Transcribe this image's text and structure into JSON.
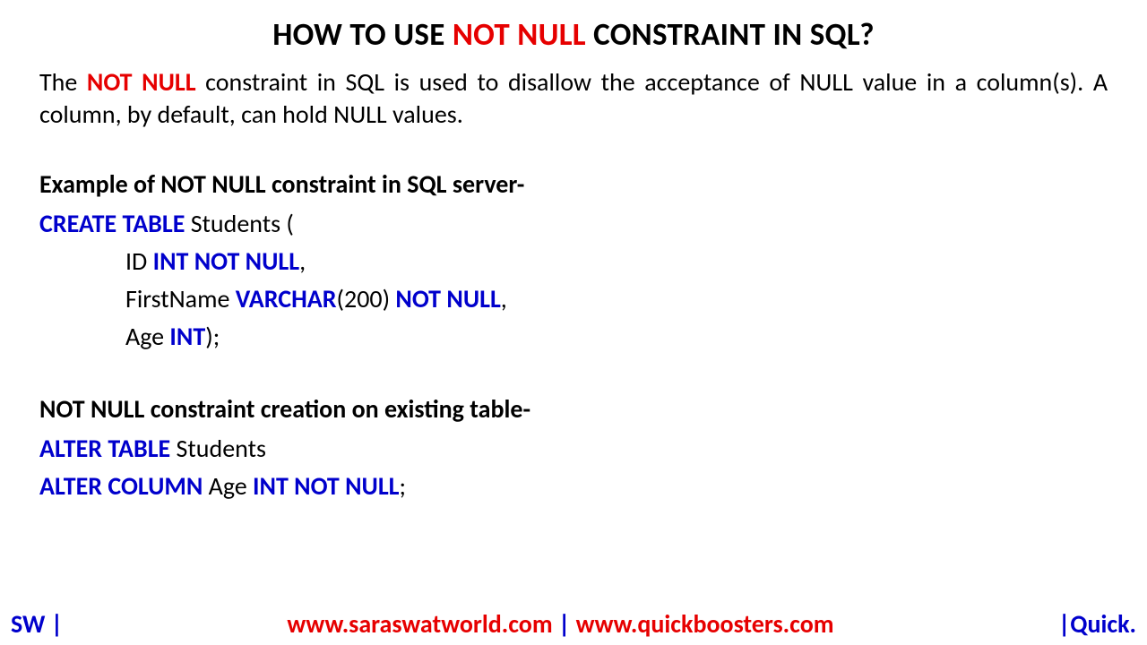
{
  "title": {
    "pre": "HOW TO USE ",
    "red": "NOT NULL",
    "post": " CONSTRAINT IN SQL?"
  },
  "intro": {
    "pre": "The ",
    "keyword": "NOT NULL",
    "post": " constraint in SQL is used to disallow the acceptance of NULL value in a column(s). A column, by default, can hold NULL values."
  },
  "section1": {
    "heading": "Example of NOT NULL constraint in SQL server-",
    "line1_kw": "CREATE TABLE",
    "line1_rest": " Students (",
    "line2_pre": "ID ",
    "line2_kw": "INT NOT NULL",
    "line2_post": ",",
    "line3_pre": "FirstName ",
    "line3_kw1": "VARCHAR",
    "line3_mid": "(200) ",
    "line3_kw2": "NOT NULL",
    "line3_post": ",",
    "line4_pre": "Age ",
    "line4_kw": "INT",
    "line4_post": ");"
  },
  "section2": {
    "heading": "NOT NULL constraint creation on existing table-",
    "line1_kw": "ALTER TABLE",
    "line1_rest": " Students",
    "line2_kw1": "ALTER COLUMN",
    "line2_mid": " Age ",
    "line2_kw2": "INT NOT NULL",
    "line2_post": ";"
  },
  "footer": {
    "left": "SW |",
    "center_site1": "www.saraswatworld.com",
    "center_sep": " | ",
    "center_site2": "www.quickboosters.com",
    "right": "|Quick."
  }
}
